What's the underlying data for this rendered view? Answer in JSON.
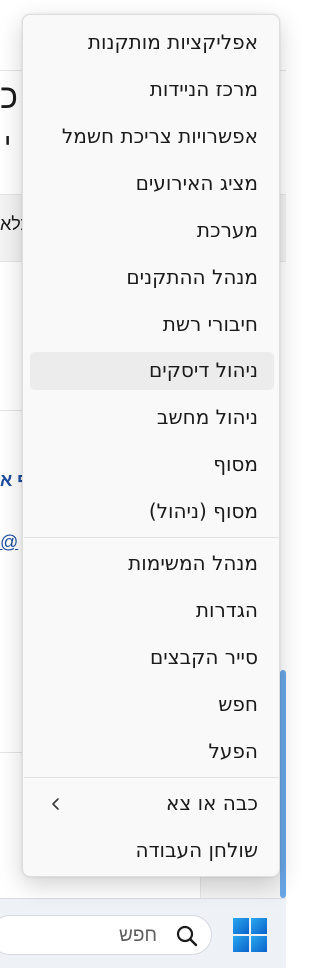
{
  "background_window": {
    "title_fragment": "כ",
    "subtitle_fragment": "י",
    "strip_fragment": "כלא",
    "link_fragment": "ף א",
    "email_fragment": "@"
  },
  "menu": {
    "items": [
      {
        "label": "אפליקציות מותקנות"
      },
      {
        "label": "מרכז הניידות"
      },
      {
        "label": "אפשרויות צריכת חשמל"
      },
      {
        "label": "מציג האירועים"
      },
      {
        "label": "מערכת"
      },
      {
        "label": "מנהל ההתקנים"
      },
      {
        "label": "חיבורי רשת"
      },
      {
        "label": "ניהול דיסקים"
      },
      {
        "label": "ניהול מחשב"
      },
      {
        "label": "מסוף"
      },
      {
        "label": "מסוף (ניהול)"
      },
      {
        "label": "מנהל המשימות"
      },
      {
        "label": "הגדרות"
      },
      {
        "label": "סייר הקבצים"
      },
      {
        "label": "חפש"
      },
      {
        "label": "הפעל"
      },
      {
        "label": "כבה או צא"
      },
      {
        "label": "שולחן העבודה"
      }
    ],
    "hovered_item": "ניהול דיסקים"
  },
  "taskbar": {
    "search_placeholder": "חפש",
    "search_icon": "search-icon",
    "start_icon": "windows-logo-icon"
  },
  "colors": {
    "accent": "#0078d4",
    "hover": "#ececec",
    "menu_bg": "#f9f9f9",
    "link": "#1f4e9c"
  }
}
